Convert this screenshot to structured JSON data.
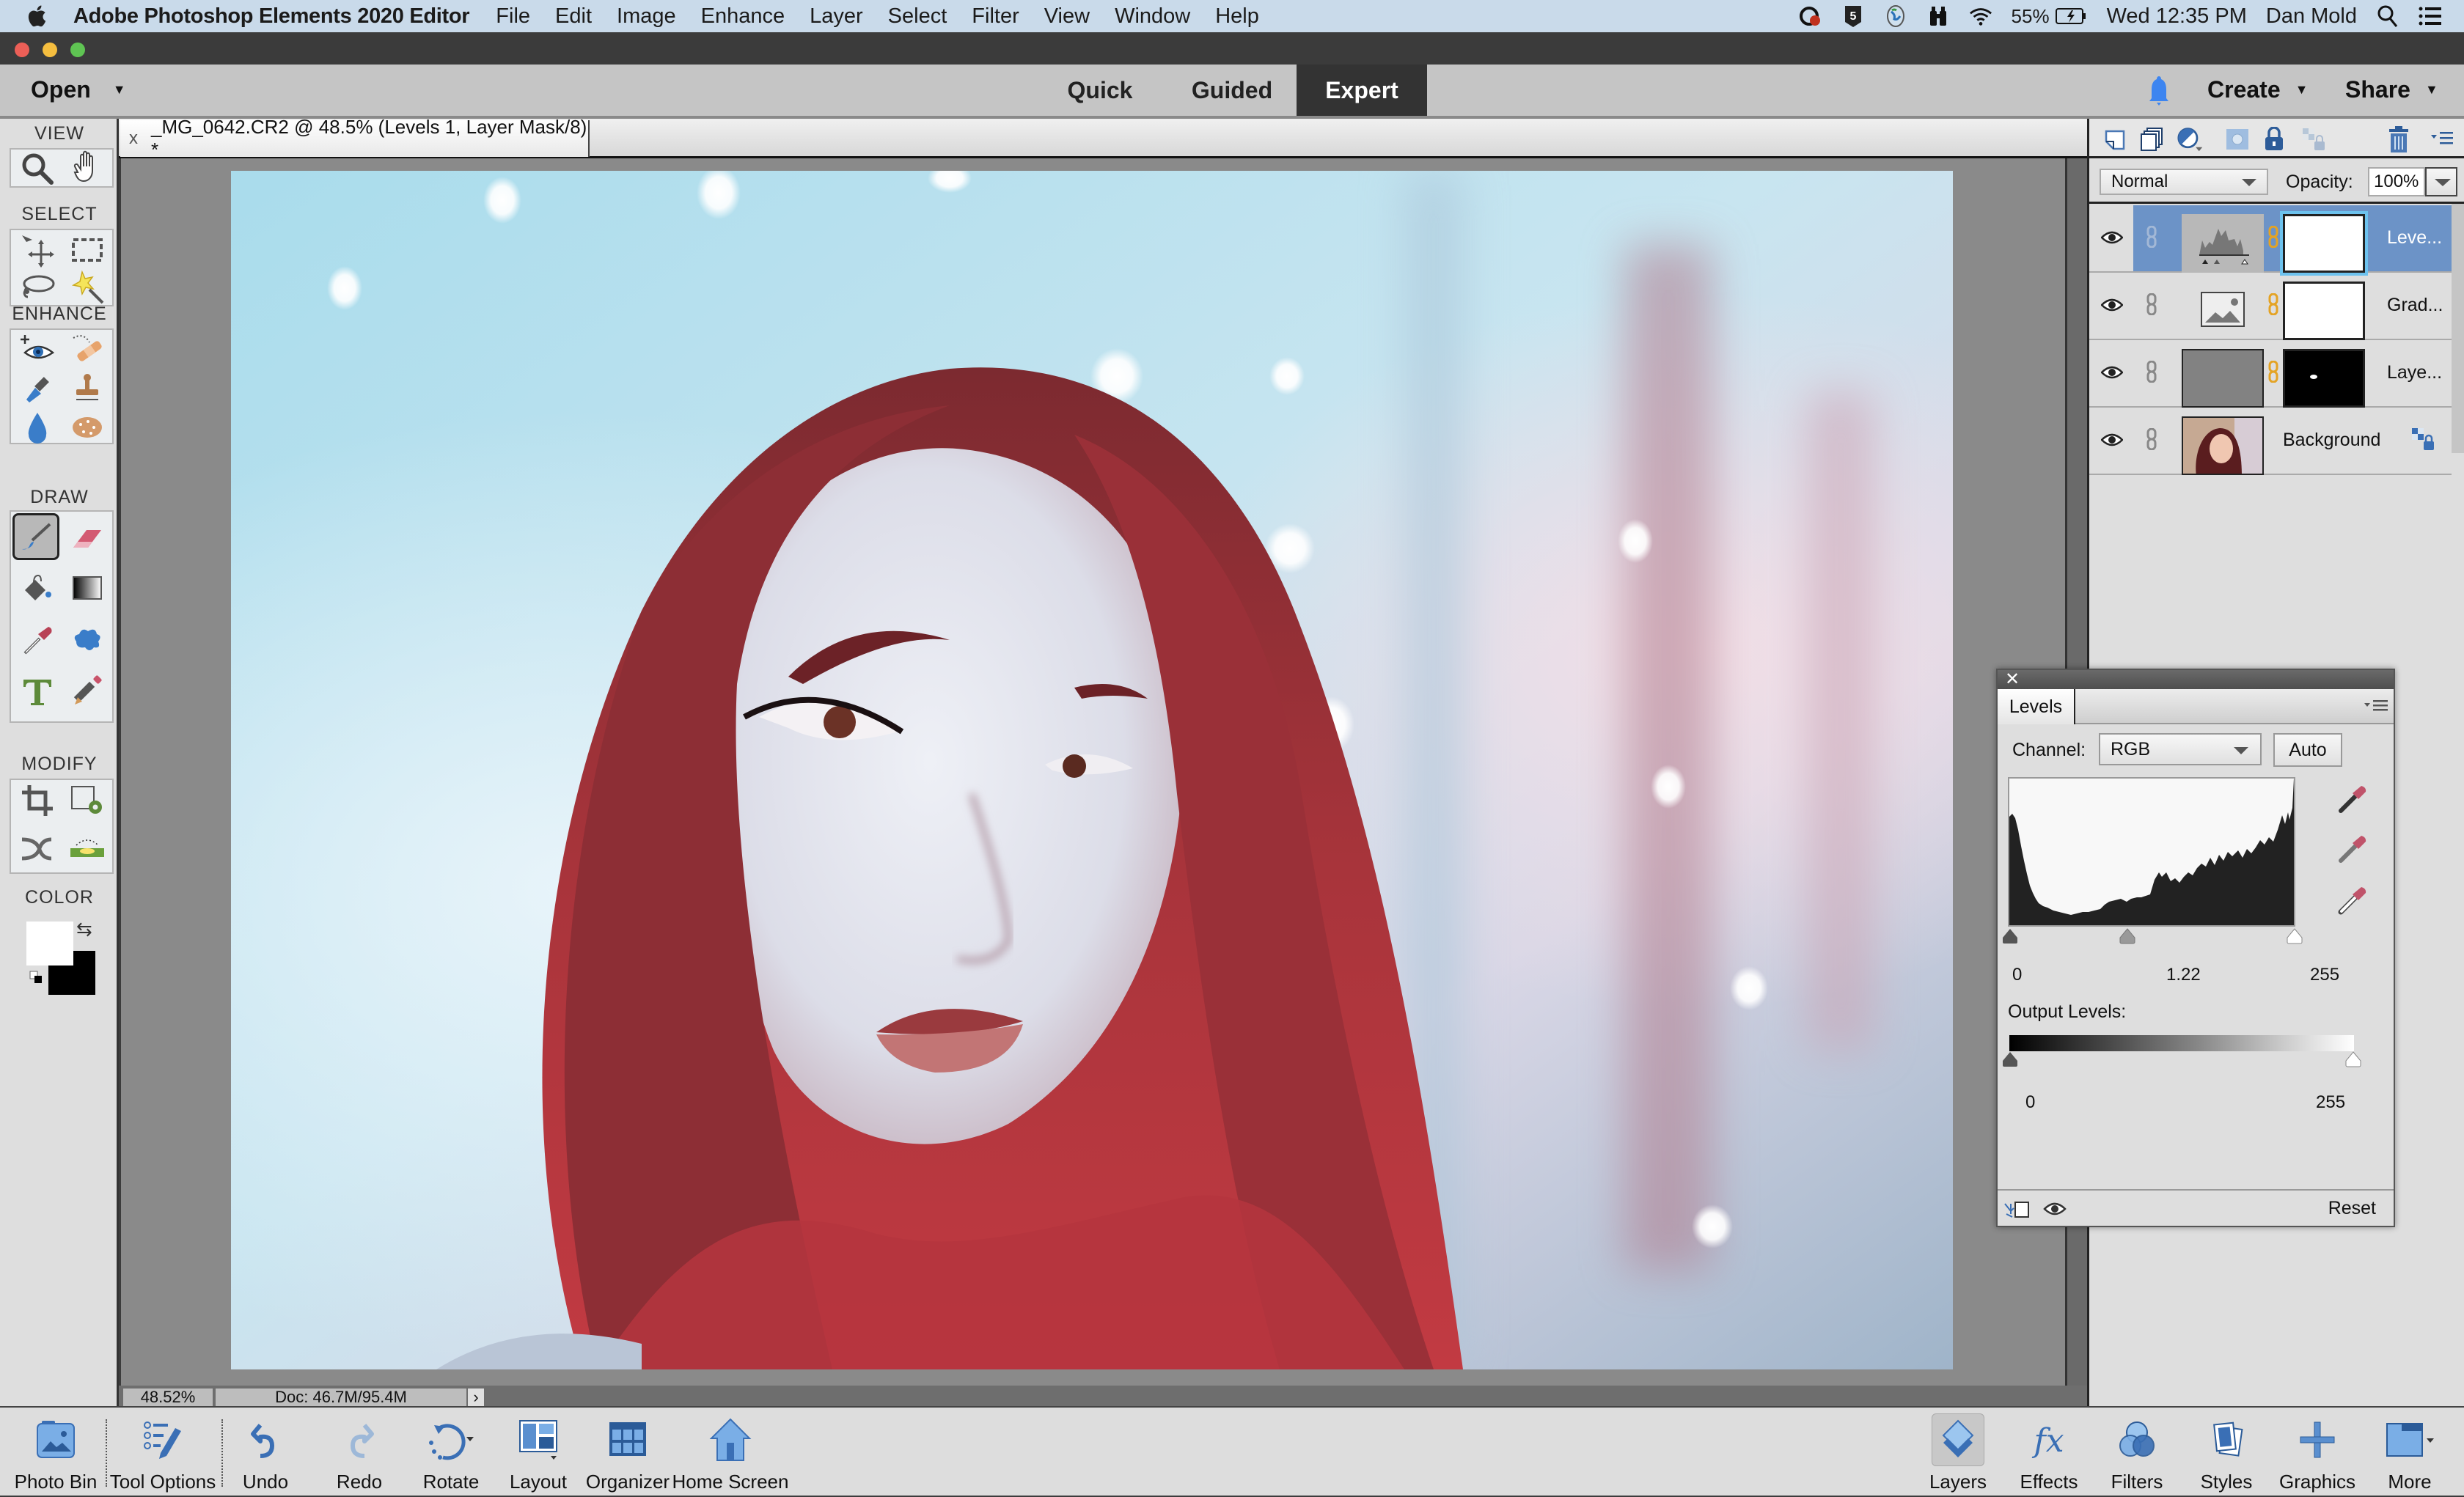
{
  "menubar": {
    "app_name": "Adobe Photoshop Elements 2020 Editor",
    "items": [
      "File",
      "Edit",
      "Image",
      "Enhance",
      "Layer",
      "Select",
      "Filter",
      "View",
      "Window",
      "Help"
    ],
    "status_icons": [
      "creative-cloud-icon",
      "script-icon",
      "globe-icon",
      "binoculars-icon",
      "wifi-icon"
    ],
    "battery": "55%",
    "clock": "Wed 12:35 PM",
    "user": "Dan Mold"
  },
  "header": {
    "open_label": "Open",
    "modes": [
      {
        "label": "Quick",
        "active": false
      },
      {
        "label": "Guided",
        "active": false
      },
      {
        "label": "Expert",
        "active": true
      }
    ],
    "create_label": "Create",
    "share_label": "Share",
    "notification_color": "#3d85f0"
  },
  "toolbox": {
    "sections": [
      {
        "label": "VIEW",
        "tools": [
          "zoom-tool",
          "hand-tool"
        ]
      },
      {
        "label": "SELECT",
        "tools": [
          "move-tool",
          "marquee-tool",
          "lasso-tool",
          "magic-wand-tool"
        ]
      },
      {
        "label": "ENHANCE",
        "tools": [
          "red-eye-tool",
          "healing-brush-tool",
          "smart-brush-tool",
          "clone-stamp-tool",
          "blur-tool",
          "sponge-tool"
        ]
      },
      {
        "label": "DRAW",
        "tools": [
          "brush-tool",
          "eraser-tool",
          "paint-bucket-tool",
          "gradient-tool",
          "color-picker-tool",
          "custom-shape-tool",
          "type-tool",
          "pencil-tool"
        ]
      },
      {
        "label": "MODIFY",
        "tools": [
          "crop-tool",
          "recompose-tool",
          "content-aware-move-tool",
          "straighten-tool"
        ]
      },
      {
        "label": "COLOR",
        "tools": []
      }
    ],
    "active_tool": "brush-tool",
    "foreground_color": "#ffffff",
    "background_color": "#000000"
  },
  "document": {
    "tab_title": "_MG_0642.CR2 @ 48.5% (Levels 1, Layer Mask/8) *",
    "close_label": "x",
    "zoom": "48.52%",
    "doc_size": "Doc: 46.7M/95.4M",
    "status_arrow": "›"
  },
  "layers_panel": {
    "blend_mode": "Normal",
    "opacity_label": "Opacity:",
    "opacity_value": "100%",
    "layers": [
      {
        "name": "Leve...",
        "type": "levels-adjustment",
        "mask": "white",
        "selected": true
      },
      {
        "name": "Grad...",
        "type": "gradient-map",
        "mask": "white",
        "selected": false
      },
      {
        "name": "Laye...",
        "type": "gray-fill",
        "mask": "black",
        "selected": false
      },
      {
        "name": "Background",
        "type": "photo",
        "mask": null,
        "selected": false,
        "locked": true
      }
    ]
  },
  "levels": {
    "tab_label": "Levels",
    "channel_label": "Channel:",
    "channel_value": "RGB",
    "auto_label": "Auto",
    "input_black": "0",
    "input_gamma": "1.22",
    "input_white": "255",
    "output_label": "Output Levels:",
    "output_black": "0",
    "output_white": "255",
    "reset_label": "Reset",
    "close_label": "✕"
  },
  "bottombar": {
    "left": [
      {
        "id": "photo-bin",
        "label": "Photo Bin"
      },
      {
        "id": "tool-options",
        "label": "Tool Options"
      },
      {
        "id": "undo",
        "label": "Undo"
      },
      {
        "id": "redo",
        "label": "Redo"
      },
      {
        "id": "rotate",
        "label": "Rotate"
      },
      {
        "id": "layout",
        "label": "Layout"
      },
      {
        "id": "organizer",
        "label": "Organizer"
      },
      {
        "id": "home-screen",
        "label": "Home Screen"
      }
    ],
    "right": [
      {
        "id": "layers",
        "label": "Layers",
        "active": true
      },
      {
        "id": "effects",
        "label": "Effects"
      },
      {
        "id": "filters",
        "label": "Filters"
      },
      {
        "id": "styles",
        "label": "Styles"
      },
      {
        "id": "graphics",
        "label": "Graphics"
      },
      {
        "id": "more",
        "label": "More"
      }
    ]
  }
}
